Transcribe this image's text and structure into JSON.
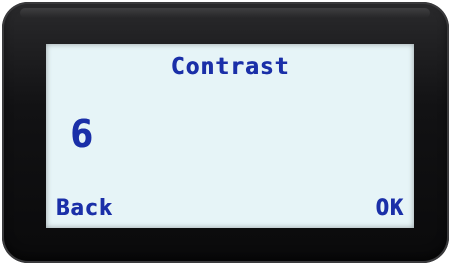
{
  "screen": {
    "title": "Contrast",
    "value": "6"
  },
  "softkeys": {
    "left_label": "Back",
    "right_label": "OK"
  },
  "colors": {
    "lcd_background": "#e6f4f7",
    "lcd_text": "#1a2fa8",
    "bezel": "#121214"
  }
}
